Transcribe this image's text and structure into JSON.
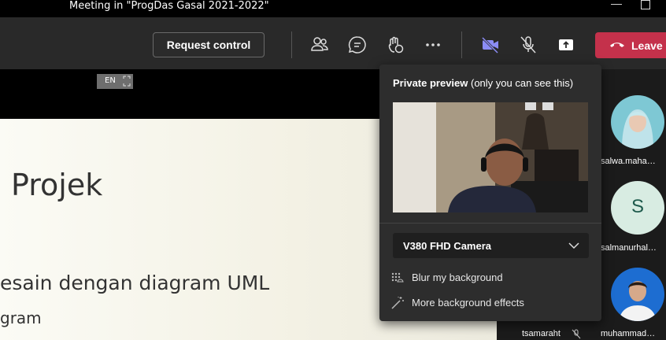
{
  "window": {
    "title": "Meeting in \"ProgDas Gasal 2021-2022\"",
    "minimize_glyph": "—",
    "maximize_glyph": "☐"
  },
  "toolbar": {
    "request_control": "Request control",
    "leave_label": "Leave",
    "icons": [
      "people-icon",
      "chat-icon",
      "raise-hand-icon",
      "more-icon",
      "camera-off-icon",
      "mic-off-icon",
      "share-tray-icon",
      "phone-hangup-icon"
    ],
    "leave_color": "#c4314b",
    "camera_accent": "#8b8cf5"
  },
  "stage": {
    "language_badge": "EN",
    "slide": {
      "title": "Projek",
      "line1": "esain dengan diagram UML",
      "line2": "gram"
    }
  },
  "popup": {
    "title_bold": "Private preview",
    "title_rest": " (only you can see this)",
    "camera_name": "V380 FHD Camera",
    "options": [
      "Blur my background",
      "More background effects"
    ]
  },
  "participants": [
    {
      "name": "salwa.maha…",
      "type": "photo"
    },
    {
      "name": "salmanurhal…",
      "type": "initial",
      "initial": "S",
      "color": "#d8ece2"
    },
    {
      "name": "muhammad…",
      "type": "photo"
    },
    {
      "name": "tsamaraht",
      "type": "label"
    }
  ]
}
